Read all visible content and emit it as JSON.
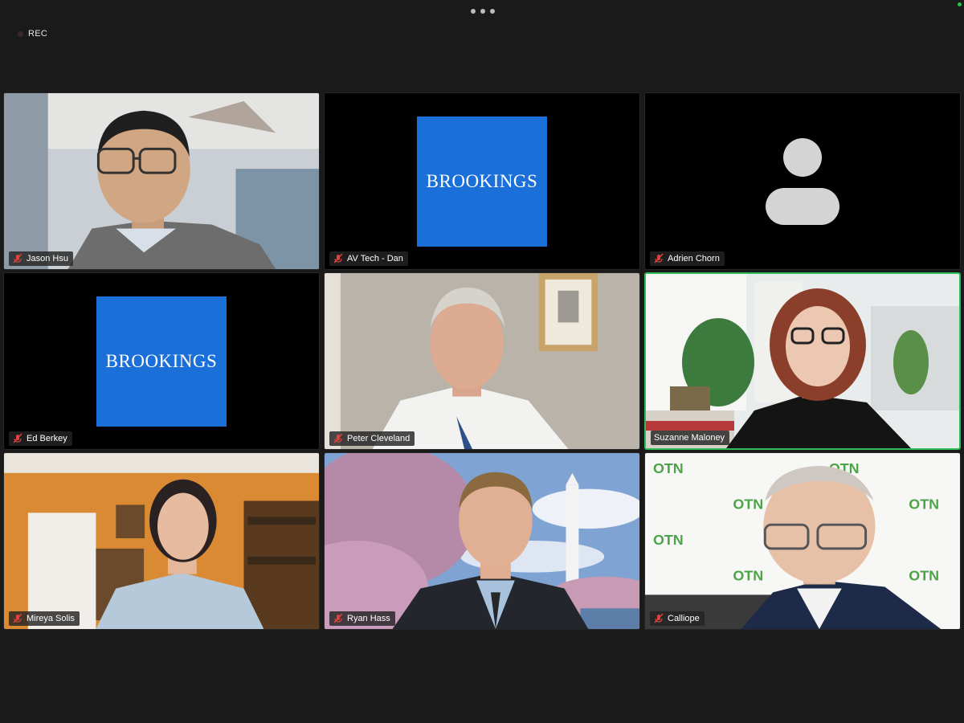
{
  "toolbar": {
    "more_icon": "more-horizontal-icon"
  },
  "recording": {
    "label": "REC"
  },
  "participants": [
    {
      "name": "Jason Hsu",
      "muted": true,
      "video": "camera"
    },
    {
      "name": "AV Tech - Dan",
      "muted": true,
      "video": "logo",
      "logo_text": "BROOKINGS"
    },
    {
      "name": "Adrien Chorn",
      "muted": true,
      "video": "avatar"
    },
    {
      "name": "Ed Berkey",
      "muted": true,
      "video": "logo",
      "logo_text": "BROOKINGS"
    },
    {
      "name": "Peter Cleveland",
      "muted": true,
      "video": "camera"
    },
    {
      "name": "Suzanne Maloney",
      "muted": true,
      "video": "camera",
      "active_speaker": true
    },
    {
      "name": "Mireya Solis",
      "muted": true,
      "video": "camera"
    },
    {
      "name": "Ryan Hass",
      "muted": true,
      "video": "camera"
    },
    {
      "name": "Calliope",
      "muted": true,
      "video": "camera",
      "backdrop_text": "OTN"
    }
  ],
  "colors": {
    "background": "#1a1a1a",
    "brookings_blue": "#1a6fd9",
    "active_border": "#2ebd59",
    "mute_red": "#e0413c"
  }
}
